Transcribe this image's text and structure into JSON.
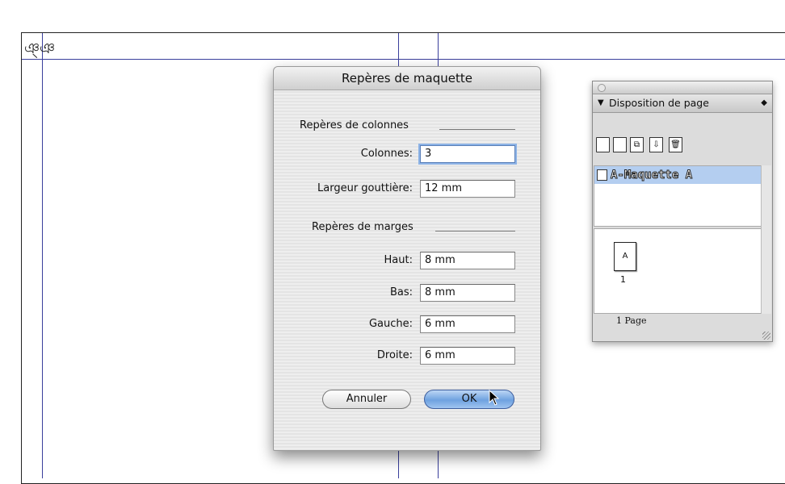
{
  "dialog": {
    "title": "Repères de maquette",
    "columns_section": "Repères de colonnes",
    "columns_label": "Colonnes:",
    "columns_value": "3",
    "gutter_label": "Largeur gouttière:",
    "gutter_value": "12 mm",
    "margins_section": "Repères de marges",
    "top_label": "Haut:",
    "top_value": "8 mm",
    "bottom_label": "Bas:",
    "bottom_value": "8 mm",
    "left_label": "Gauche:",
    "left_value": "6 mm",
    "right_label": "Droite:",
    "right_value": "6 mm",
    "cancel_label": "Annuler",
    "ok_label": "OK"
  },
  "pages_panel": {
    "title": "Disposition de page",
    "master_item": "A-Maquette A",
    "page_thumb_label": "A",
    "page_number": "1",
    "footer": "1 Page"
  },
  "colors": {
    "guide": "#3a3f9c",
    "ok_button": "#6fa2e0",
    "selection": "#b4cef0"
  }
}
